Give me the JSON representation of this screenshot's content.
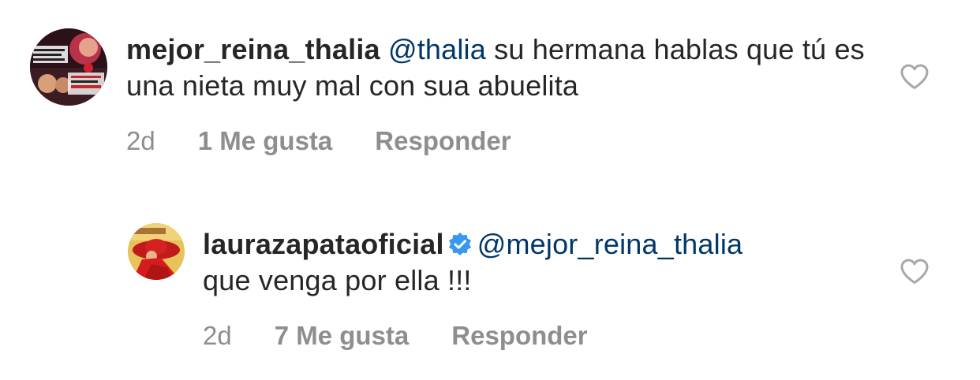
{
  "comments": [
    {
      "username": "mejor_reina_thalia",
      "mention": "@thalia",
      "text": " su hermana hablas que tú es una nieta muy mal con sua abuelita",
      "time": "2d",
      "likes": "1 Me gusta",
      "reply": "Responder",
      "verified": false,
      "avatar": "mejor-reina-thalia-avatar",
      "like_icon": "heart-outline-icon"
    },
    {
      "username": "laurazapataoficial",
      "mention": "@mejor_reina_thalia",
      "text": "que venga por ella !!!",
      "time": "2d",
      "likes": "7 Me gusta",
      "reply": "Responder",
      "verified": true,
      "avatar": "laurazapataoficial-avatar",
      "like_icon": "heart-outline-icon"
    }
  ],
  "colors": {
    "text": "#262626",
    "mention": "#00376b",
    "meta": "#8e8e8e",
    "verified": "#3897f0",
    "heart_stroke": "#a8a8a8"
  }
}
